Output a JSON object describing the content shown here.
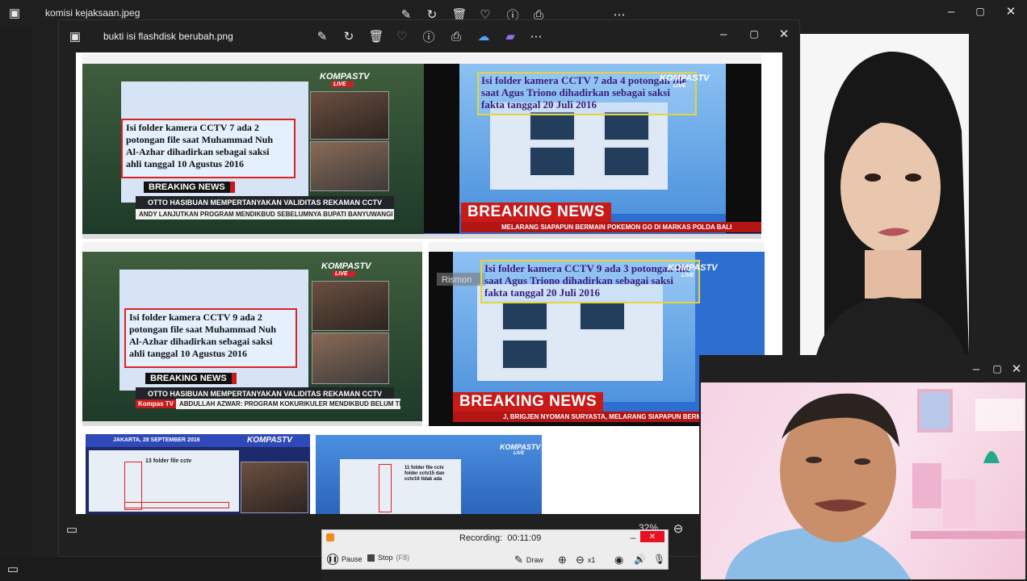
{
  "back_window": {
    "title": "komisi kejaksaan.jpeg"
  },
  "photo_window": {
    "title": "bukti isi flashdisk berubah.png",
    "zoom": "32%",
    "toolbar_icons": [
      "edit-icon",
      "rotate-icon",
      "delete-icon",
      "favorite-icon",
      "info-icon",
      "print-icon",
      "share-icon",
      "clipchamp-icon",
      "more-icon"
    ],
    "screenshots": {
      "top_left": {
        "caption": "Isi folder kamera CCTV 7 ada 2\npotongan file saat Muhammad Nuh\nAl-Azhar dihadirkan sebagai saksi\nahli tanggal 10 Agustus 2016",
        "breaking": "BREAKING NEWS",
        "ticker": "OTTO HASIBUAN MEMPERTANYAKAN VALIDITAS REKAMAN CCTV",
        "sub_ticker": "ANDY LANJUTKAN PROGRAM MENDIKBUD SEBELUMNYA  BUPATI BANYUWANGI",
        "logo": "KOMPASTV",
        "logo_sub": "LIVE"
      },
      "top_right": {
        "caption": "Isi folder kamera CCTV 7 ada 4 potongan file\nsaat Agus Triono dihadirkan sebagai saksi\nfakta tanggal 20 Juli 2016",
        "breaking": "BREAKING NEWS",
        "ticker": "MELARANG SIAPAPUN BERMAIN POKEMON GO DI MARKAS POLDA BALI",
        "logo": "KOMPASTV",
        "logo_sub": "LIVE"
      },
      "mid_left": {
        "caption": "Isi folder kamera CCTV 9 ada 2\npotongan file saat Muhammad Nuh\nAl-Azhar dihadirkan sebagai saksi\nahli tanggal 10 Agustus 2016",
        "breaking": "BREAKING NEWS",
        "ticker": "OTTO HASIBUAN MEMPERTANYAKAN VALIDITAS REKAMAN CCTV",
        "sub_ticker": "ABDULLAH AZWAR: PROGRAM KOKURIKULER MENDIKBUD BELUM TENTU COCOK D",
        "brand": "Kompas TV",
        "logo": "KOMPASTV",
        "logo_sub": "LIVE"
      },
      "mid_right": {
        "caption": "Isi folder kamera CCTV 9 ada 3 potongan file\nsaat Agus Triono dihadirkan sebagai saksi\nfakta tanggal 20 Juli 2016",
        "breaking": "BREAKING NEWS",
        "ticker": "J, BRIGJEN NYOMAN SURYASTA, MELARANG SIAPAPUN BERMAI",
        "overlay": "Rismon",
        "logo": "KOMPASTV",
        "logo_sub": "LIVE"
      },
      "bottom_left": {
        "header": "JAKARTA, 28 SEPTEMBER 2016",
        "logo": "KOMPASTV",
        "label": "13 folder file cctv"
      },
      "bottom_right": {
        "logo": "KOMPASTV",
        "logo_sub": "LIVE",
        "label": "11 folder file cctv\nfolder cctv15 dan\ncctv16 tidak ada"
      }
    }
  },
  "recorder": {
    "status_label": "Recording:",
    "time": "00:11:09",
    "pause_label": "Pause",
    "stop_label": "Stop",
    "stop_shortcut": "(F8)",
    "draw_label": "Draw",
    "zoom_level": "x1"
  },
  "colors": {
    "accent_red": "#c91a1a",
    "caption_yellow": "#e5d53a"
  }
}
